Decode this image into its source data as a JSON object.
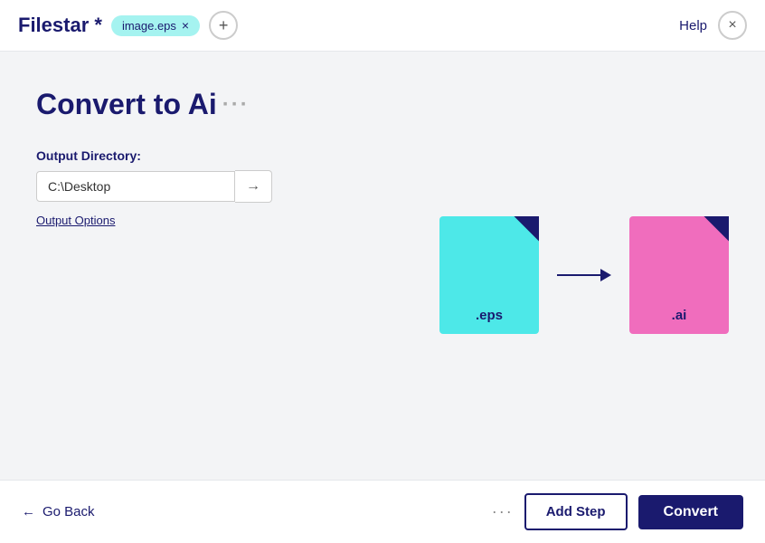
{
  "header": {
    "app_title": "Filestar *",
    "file_tag": "image.eps",
    "help_label": "Help",
    "close_icon": "×",
    "add_icon": "+"
  },
  "main": {
    "page_title": "Convert to Ai",
    "title_dots": "···",
    "output_directory_label": "Output Directory:",
    "output_directory_value": "C:\\Desktop",
    "output_options_label": "Output Options",
    "from_ext": ".eps",
    "to_ext": ".ai"
  },
  "footer": {
    "go_back_label": "Go Back",
    "more_dots": "···",
    "add_step_label": "Add Step",
    "convert_label": "Convert"
  },
  "colors": {
    "brand_dark": "#1a1a6e",
    "file_cyan": "#4de8e8",
    "file_pink": "#f06dbd",
    "tag_cyan": "#a5f3f0"
  }
}
